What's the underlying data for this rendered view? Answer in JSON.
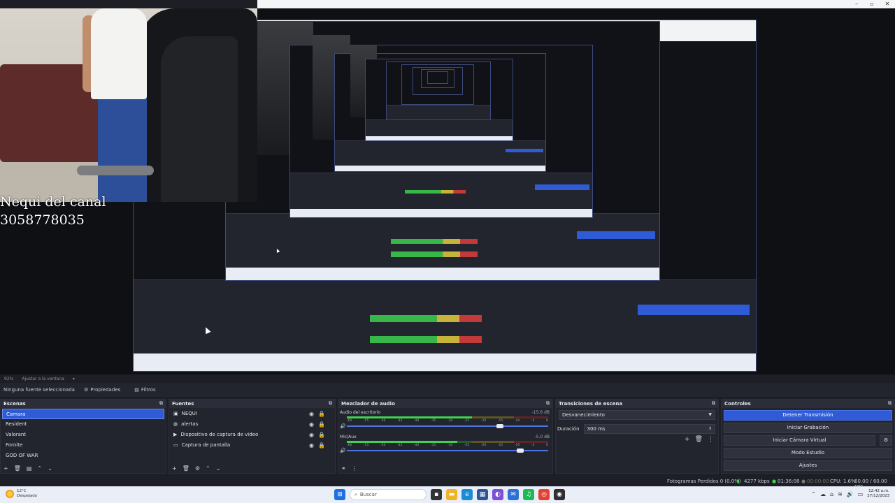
{
  "overlay": {
    "line1": "Nequi del canal",
    "line2": "3058778035"
  },
  "zoom": {
    "level": "92%",
    "fit": "Ajustar a la ventana"
  },
  "toolbar": {
    "no_source": "Ninguna fuente seleccionada",
    "properties": "Propiedades",
    "filters": "Filtros"
  },
  "scenes": {
    "title": "Escenas",
    "items": [
      "Camara",
      "Resident",
      "Valorant",
      "Fornite",
      "GOD OF WAR"
    ],
    "selected": 0
  },
  "sources": {
    "title": "Fuentes",
    "items": [
      "NEQUI",
      "alertas",
      "Dispositivo de captura de video",
      "Captura de pantalla"
    ]
  },
  "mixer": {
    "title": "Mezclador de audio",
    "channels": [
      {
        "name": "Audio del escritorio",
        "db": "-15.6 dB",
        "level": 0.62,
        "volume": 0.76
      },
      {
        "name": "Mic/Aux",
        "db": "-5.0 dB",
        "level": 0.55,
        "volume": 0.86
      }
    ],
    "ticks": [
      "-60",
      "-55",
      "-50",
      "-45",
      "-40",
      "-35",
      "-30",
      "-25",
      "-20",
      "-15",
      "-10",
      "-5",
      "0"
    ]
  },
  "transitions": {
    "title": "Transiciones de escena",
    "transition": "Desvanecimiento",
    "duration_label": "Duración",
    "duration_value": "300 ms"
  },
  "controls": {
    "title": "Controles",
    "stop_stream": "Detener Transmisión",
    "start_record": "Iniciar Grabación",
    "virtual_cam": "Iniciar Cámara Virtual",
    "studio_mode": "Modo Estudio",
    "settings": "Ajustes"
  },
  "status": {
    "dropped": "Fotogramas Perdidos 0 (0.0%)",
    "kbps": "4277 kbps",
    "live_time": "01:36:08",
    "rec_time": "00:00:00",
    "cpu": "CPU: 1.6%",
    "fps": "60.00 / 60.00 FPS"
  },
  "taskbar": {
    "temp": "12°C",
    "weather": "Despejado",
    "search": "Buscar",
    "time": "12:42 a.m.",
    "date": "27/12/2023"
  },
  "colors": {
    "accent": "#2f5bd7",
    "dock_bg": "#23252e",
    "meter_green": "#3fd14f"
  }
}
